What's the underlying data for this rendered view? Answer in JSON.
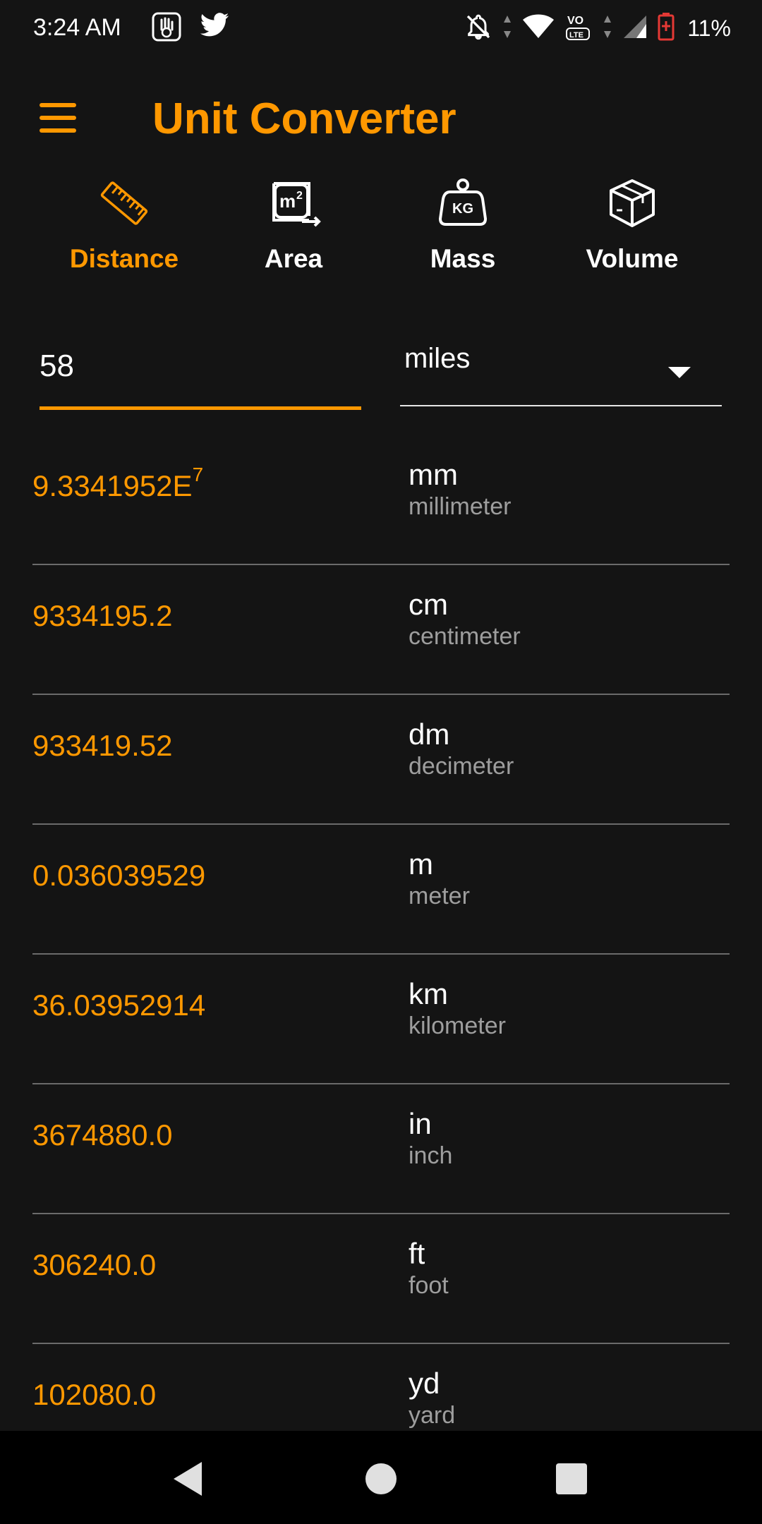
{
  "status": {
    "time": "3:24 AM",
    "battery": "11%"
  },
  "app": {
    "title": "Unit Converter"
  },
  "colors": {
    "accent": "#ff9800",
    "background": "#141414",
    "secondary_text": "#9e9e9e"
  },
  "tabs": [
    {
      "label": "Distance",
      "icon": "ruler-icon",
      "active": true
    },
    {
      "label": "Area",
      "icon": "area-m2-icon",
      "active": false
    },
    {
      "label": "Mass",
      "icon": "weight-kg-icon",
      "active": false
    },
    {
      "label": "Volume",
      "icon": "box-icon",
      "active": false
    }
  ],
  "input": {
    "value": "58",
    "unit": "miles"
  },
  "results": [
    {
      "value": "9.3341952E",
      "exp": "7",
      "abbr": "mm",
      "name": "millimeter"
    },
    {
      "value": "9334195.2",
      "abbr": "cm",
      "name": "centimeter"
    },
    {
      "value": "933419.52",
      "abbr": "dm",
      "name": "decimeter"
    },
    {
      "value": "0.036039529",
      "abbr": "m",
      "name": "meter"
    },
    {
      "value": "36.03952914",
      "abbr": "km",
      "name": "kilometer"
    },
    {
      "value": "3674880.0",
      "abbr": "in",
      "name": "inch"
    },
    {
      "value": "306240.0",
      "abbr": "ft",
      "name": "foot"
    },
    {
      "value": "102080.0",
      "abbr": "yd",
      "name": "yard"
    }
  ]
}
